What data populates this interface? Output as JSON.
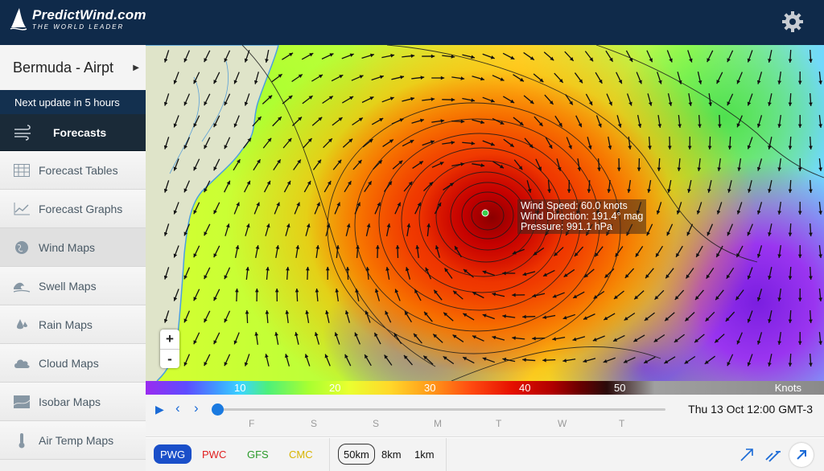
{
  "header": {
    "brand": "PredictWind.com",
    "tagline": "THE WORLD LEADER",
    "settings_icon": "gear-icon"
  },
  "sidebar": {
    "location": "Bermuda - Airpt",
    "next_update": "Next update in 5 hours",
    "forecasts_label": "Forecasts",
    "items": [
      {
        "label": "Forecast Tables",
        "icon": "table-icon"
      },
      {
        "label": "Forecast Graphs",
        "icon": "graph-icon"
      },
      {
        "label": "Wind Maps",
        "icon": "globe-icon"
      },
      {
        "label": "Swell Maps",
        "icon": "wave-icon"
      },
      {
        "label": "Rain Maps",
        "icon": "raindrop-icon"
      },
      {
        "label": "Cloud Maps",
        "icon": "cloud-icon"
      },
      {
        "label": "Isobar Maps",
        "icon": "isobar-icon"
      },
      {
        "label": "Air Temp Maps",
        "icon": "thermometer-icon"
      }
    ]
  },
  "map": {
    "tooltip": {
      "speed": "Wind Speed: 60.0 knots",
      "direction": "Wind Direction: 191.4° mag",
      "pressure": "Pressure: 991.1 hPa"
    },
    "zoom_in": "+",
    "zoom_out": "-"
  },
  "legend": {
    "ticks": [
      "10",
      "20",
      "30",
      "40",
      "50"
    ],
    "unit": "Knots"
  },
  "timeline": {
    "days": [
      "F",
      "S",
      "S",
      "M",
      "T",
      "W",
      "T"
    ],
    "datetime": "Thu 13 Oct 12:00 GMT-3"
  },
  "toolbar": {
    "models": [
      {
        "label": "PWG",
        "color": "#ffffff"
      },
      {
        "label": "PWC",
        "color": "#e02020"
      },
      {
        "label": "GFS",
        "color": "#2a9a2a"
      },
      {
        "label": "CMC",
        "color": "#d8b400"
      }
    ],
    "resolutions": [
      "50km",
      "8km",
      "1km"
    ]
  }
}
